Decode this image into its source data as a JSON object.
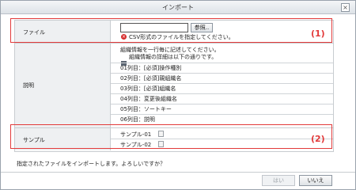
{
  "window": {
    "title": "インポート",
    "close_glyph": "×"
  },
  "file_row": {
    "label": "ファイル",
    "browse_button": "参照..",
    "error_icon": "error-icon",
    "error_text": "CSV形式のファイルを指定してください。",
    "marker": "(1)"
  },
  "desc_row": {
    "label": "説明",
    "line1": "組織情報を一行毎に記述してください。",
    "line2_icon": "minus-icon",
    "line2": "組織情報の詳細は以下の通りです。",
    "items": [
      "01列目：[必須]操作種別",
      "02列目：[必須]親組織名",
      "03列目：[必須]組織名",
      "04列目：変更後組織名",
      "05列目：ソートキー",
      "06列目：説明"
    ]
  },
  "sample_row": {
    "label": "サンプル",
    "items": [
      "サンプル-01",
      "サンプル-02"
    ],
    "item_icon": "document-icon",
    "marker": "(2)"
  },
  "confirm_text": "指定されたファイルをインポートします。よろしいですか？",
  "buttons": {
    "yes": "はい",
    "no": "いいえ"
  },
  "colors": {
    "highlight": "#e23a3a",
    "label_bg": "#eef0f2",
    "error": "#d62b2b"
  }
}
